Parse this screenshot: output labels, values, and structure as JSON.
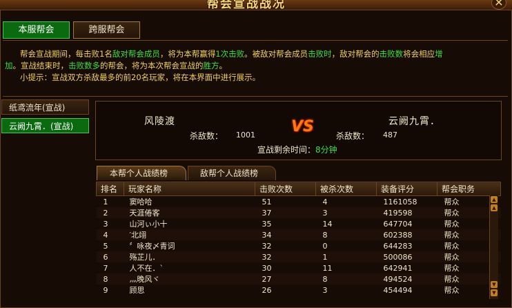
{
  "window": {
    "title": "帮会宣战战况",
    "close_label": "✕"
  },
  "tabs": [
    {
      "label": "本服帮会"
    },
    {
      "label": "跨服帮会"
    }
  ],
  "info": {
    "l1_a": "帮会宣战期间，每击败1名",
    "l1_b": "敌对帮会成员",
    "l1_c": "，将为本帮赢得",
    "l1_d": "1次击败",
    "l1_e": "。被敌对帮会成员",
    "l1_f": "击败时",
    "l1_g": "，敌对帮会的",
    "l1_h": "击败数",
    "l1_i": "将会相应",
    "l1_j": "增",
    "l2_a": "加",
    "l2_b": "。宣战结束时，",
    "l2_c": "击败数多",
    "l2_d": "的帮会，将为本次帮会宣战的",
    "l2_e": "胜方",
    "l2_f": "。",
    "l3": "小提示：宣战双方杀敌最多的前20名玩家，将在本界面中进行展示。"
  },
  "sidebar": [
    {
      "label": "纸鸢流年(宣战)"
    },
    {
      "label": "云阙九霄．(宣战)"
    }
  ],
  "battle": {
    "left_guild": "风陵渡",
    "right_guild": "云阙九霄．",
    "kill_label": "杀敌数：",
    "left_kills": "1001",
    "right_kills": "487",
    "vs": "VS",
    "time_label": "宣战剩余时间：",
    "time_value": "8分钟"
  },
  "sub_tabs": [
    {
      "label": "本帮个人战绩榜"
    },
    {
      "label": "敌帮个人战绩榜"
    }
  ],
  "table": {
    "headers": [
      "排名",
      "玩家名称",
      "击败次数",
      "被杀次数",
      "装备评分",
      "帮会职务"
    ],
    "rows": [
      [
        "1",
        "窦哈哈",
        "51",
        "4",
        "1161058",
        "帮众"
      ],
      [
        "2",
        "天涯倦客",
        "37",
        "3",
        "419598",
        "帮众"
      ],
      [
        "3",
        "山河ぃ小十",
        "35",
        "14",
        "647704",
        "帮众"
      ],
      [
        "4",
        "′北翊",
        "34",
        "8",
        "602388",
        "帮众"
      ],
      [
        "5",
        "〞咏夜〆青词",
        "32",
        "0",
        "644283",
        "帮众"
      ],
      [
        "6",
        "殇芷儿．",
        "32",
        "1",
        "500086",
        "帮众"
      ],
      [
        "7",
        "人不在．`",
        "30",
        "11",
        "642941",
        "帮众"
      ],
      [
        "8",
        "灬晚风ヾ",
        "27",
        "8",
        "494524",
        "帮众"
      ],
      [
        "9",
        "顾思",
        "26",
        "3",
        "454494",
        "帮众"
      ]
    ]
  }
}
